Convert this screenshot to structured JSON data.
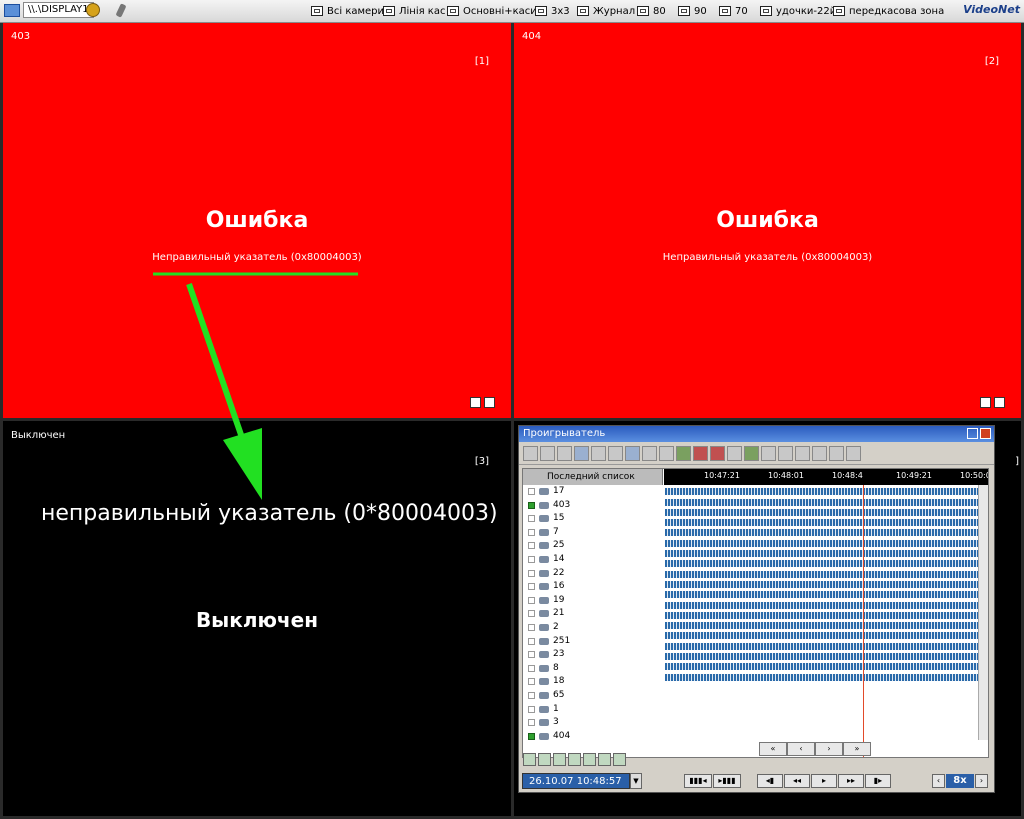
{
  "toolbar": {
    "display": "\\\\.\\DISPLAY1",
    "layouts": [
      "Всі камери",
      "Лінія кас",
      "Основні+каси",
      "3x3",
      "Журнал",
      "80",
      "90",
      "70",
      "удочки-22й",
      "передкасова зона"
    ],
    "brand": "VideoNet"
  },
  "cells": {
    "c1": {
      "id": "403",
      "num": "[1]",
      "error_title": "Ошибка",
      "error_msg": "Неправильный указатель (0x80004003)"
    },
    "c2": {
      "id": "404",
      "num": "[2]",
      "error_title": "Ошибка",
      "error_msg": "Неправильный указатель (0x80004003)"
    },
    "c3": {
      "status": "Выключен",
      "num": "[3]",
      "annotation": "неправильный указатель (0*80004003)",
      "big_status": "Выключен"
    },
    "c4": {
      "num": "]"
    }
  },
  "player": {
    "title": "Проигрыватель",
    "list_header": "Последний список",
    "times": [
      "10:47:21",
      "10:48:01",
      "10:48:4",
      "10:49:21",
      "10:50:0"
    ],
    "cameras": [
      {
        "n": "17",
        "on": false
      },
      {
        "n": "403",
        "on": true
      },
      {
        "n": "15",
        "on": false
      },
      {
        "n": "7",
        "on": false
      },
      {
        "n": "25",
        "on": false
      },
      {
        "n": "14",
        "on": false
      },
      {
        "n": "22",
        "on": false
      },
      {
        "n": "16",
        "on": false
      },
      {
        "n": "19",
        "on": false
      },
      {
        "n": "21",
        "on": false
      },
      {
        "n": "2",
        "on": false
      },
      {
        "n": "251",
        "on": false
      },
      {
        "n": "23",
        "on": false
      },
      {
        "n": "8",
        "on": false
      },
      {
        "n": "18",
        "on": false
      },
      {
        "n": "65",
        "on": false
      },
      {
        "n": "1",
        "on": false
      },
      {
        "n": "3",
        "on": false
      },
      {
        "n": "404",
        "on": true
      }
    ],
    "nav": [
      "«",
      "‹",
      "›",
      "»"
    ],
    "datetime": "26.10.07 10:48:57",
    "controls": [
      "▮▮▮◂",
      "▸▮▮▮",
      "◂▮",
      "◂◂",
      "▸",
      "▸▸",
      "▮▸"
    ],
    "speed": "8x"
  },
  "colors": {
    "error_bg": "#ff0000",
    "arrow": "#22e022",
    "off_bg": "#000000"
  }
}
